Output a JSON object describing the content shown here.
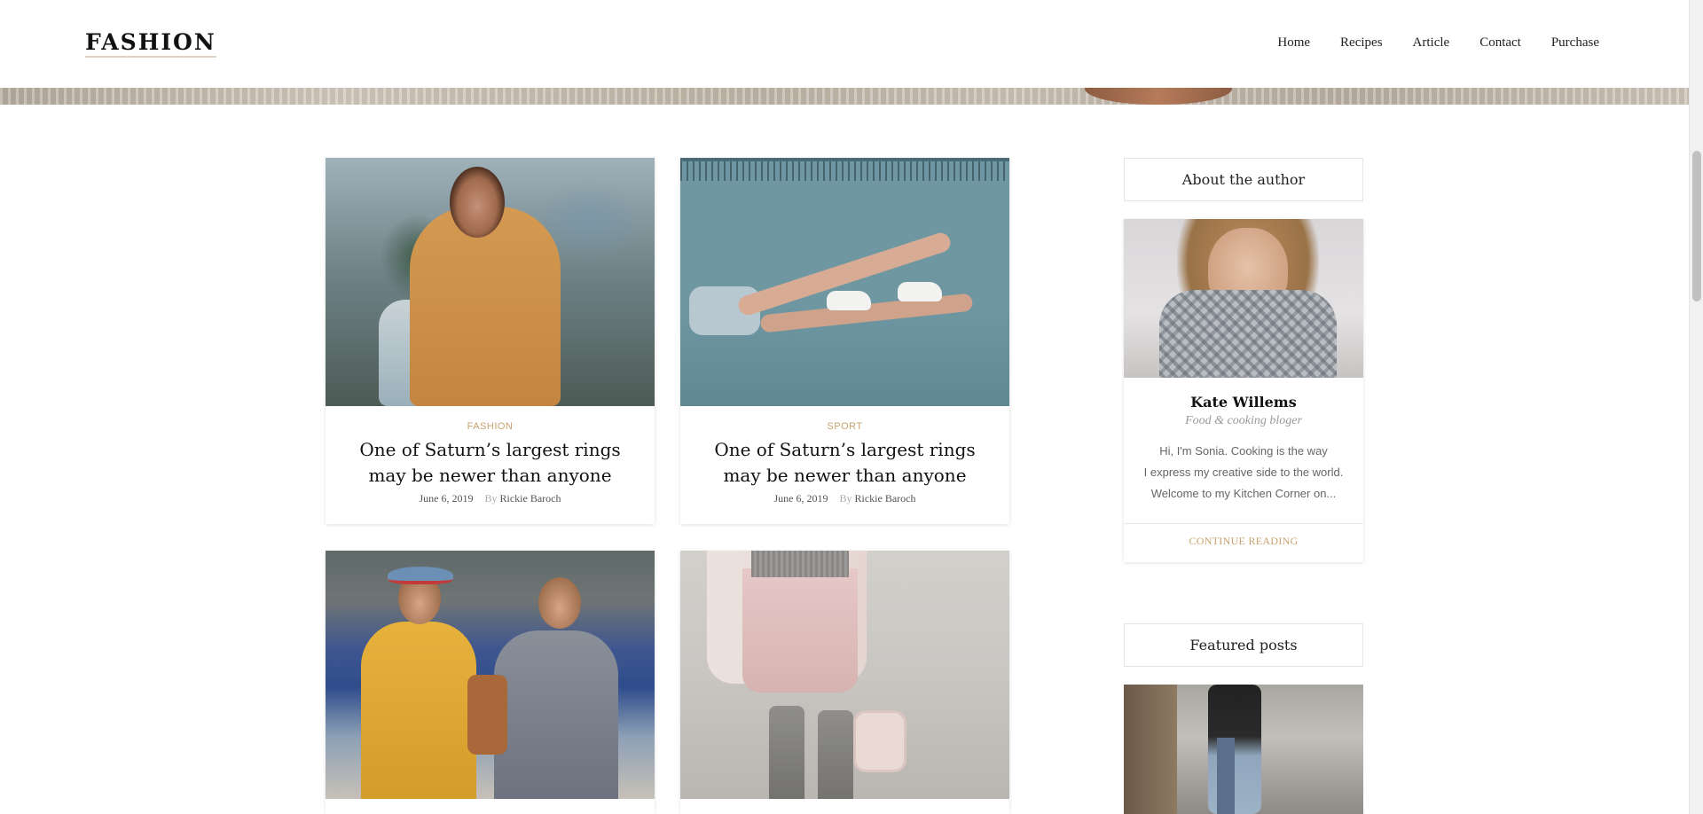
{
  "header": {
    "logo": "FASHION",
    "nav": [
      "Home",
      "Recipes",
      "Article",
      "Contact",
      "Purchase"
    ]
  },
  "posts": [
    {
      "category": "FASHION",
      "title": "One of Saturn’s largest rings may be newer than anyone",
      "date": "June 6, 2019",
      "by": "By",
      "author": "Rickie Baroch"
    },
    {
      "category": "SPORT",
      "title": "One of Saturn’s largest rings may be newer than anyone",
      "date": "June 6, 2019",
      "by": "By",
      "author": "Rickie Baroch"
    }
  ],
  "sidebar": {
    "about_title": "About the author",
    "author_name": "Kate Willems",
    "author_role": "Food & cooking bloger",
    "bio_lines": [
      "Hi, I'm Sonia. Cooking is the way",
      "I express my creative side to the world.",
      "Welcome to my Kitchen Corner on..."
    ],
    "continue_label": "CONTINUE READING",
    "featured_title": "Featured posts"
  },
  "colors": {
    "accent": "#c8a26e",
    "text": "#222222",
    "muted": "#999999"
  }
}
